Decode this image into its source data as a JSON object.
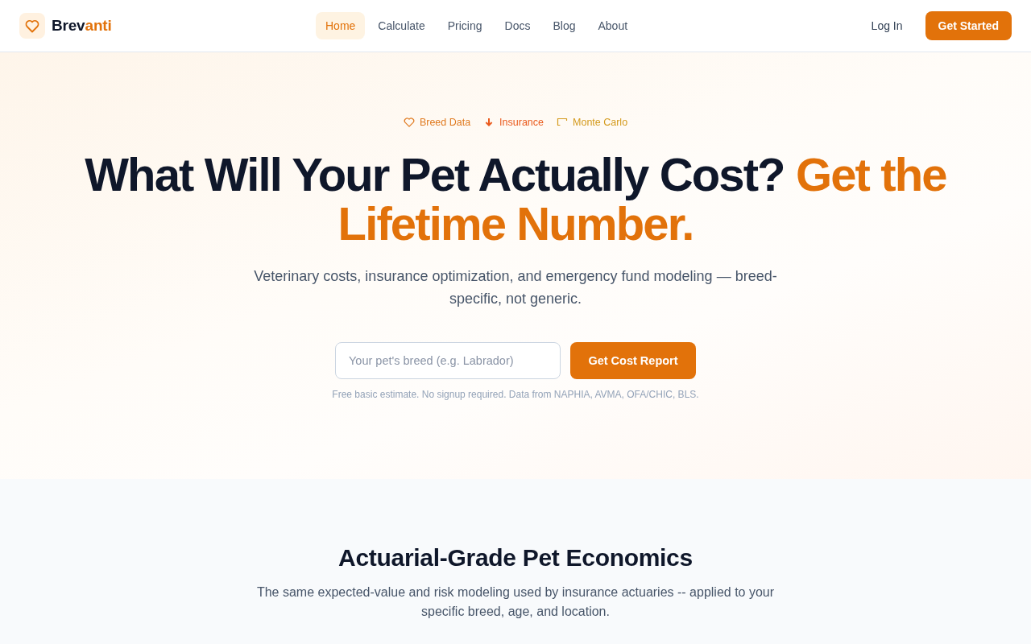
{
  "nav": {
    "brand": {
      "parts": [
        {
          "text": "Brev",
          "accent": false
        },
        {
          "text": "anti",
          "accent": true
        }
      ]
    },
    "links": [
      {
        "label": "Home",
        "selected": true
      },
      {
        "label": "Calculate",
        "selected": false
      },
      {
        "label": "Pricing",
        "selected": false
      },
      {
        "label": "Docs",
        "selected": false
      },
      {
        "label": "Blog",
        "selected": false
      },
      {
        "label": "About",
        "selected": false
      }
    ],
    "login": "Log In",
    "cta": "Get Started"
  },
  "hero": {
    "badges": [
      {
        "kind": "heart",
        "label": "Breed Data",
        "color": "#e07a1f"
      },
      {
        "kind": "arrow",
        "label": "Insurance",
        "color": "#ea5a1c"
      },
      {
        "kind": "bracket",
        "label": "Monte Carlo",
        "color": "#d49a1c"
      }
    ],
    "headline": [
      {
        "text": "What Will Your Pet Actually Cost?",
        "accent": false
      },
      {
        "text": "Get the Lifetime Number.",
        "accent": true
      }
    ],
    "subtitle": "Veterinary costs, insurance optimization, and emergency fund modeling — breed-specific, not generic.",
    "breed_field": {
      "placeholder": "Your pet's breed (e.g. Labrador)"
    },
    "submit": "Get Cost Report",
    "note": "Free basic estimate. No signup required. Data from NAPHIA, AVMA, OFA/CHIC, BLS."
  },
  "features": {
    "title": "Actuarial-Grade Pet Economics",
    "subtitle": "The same expected-value and risk modeling used by insurance actuaries -- applied to your specific breed, age, and location."
  }
}
